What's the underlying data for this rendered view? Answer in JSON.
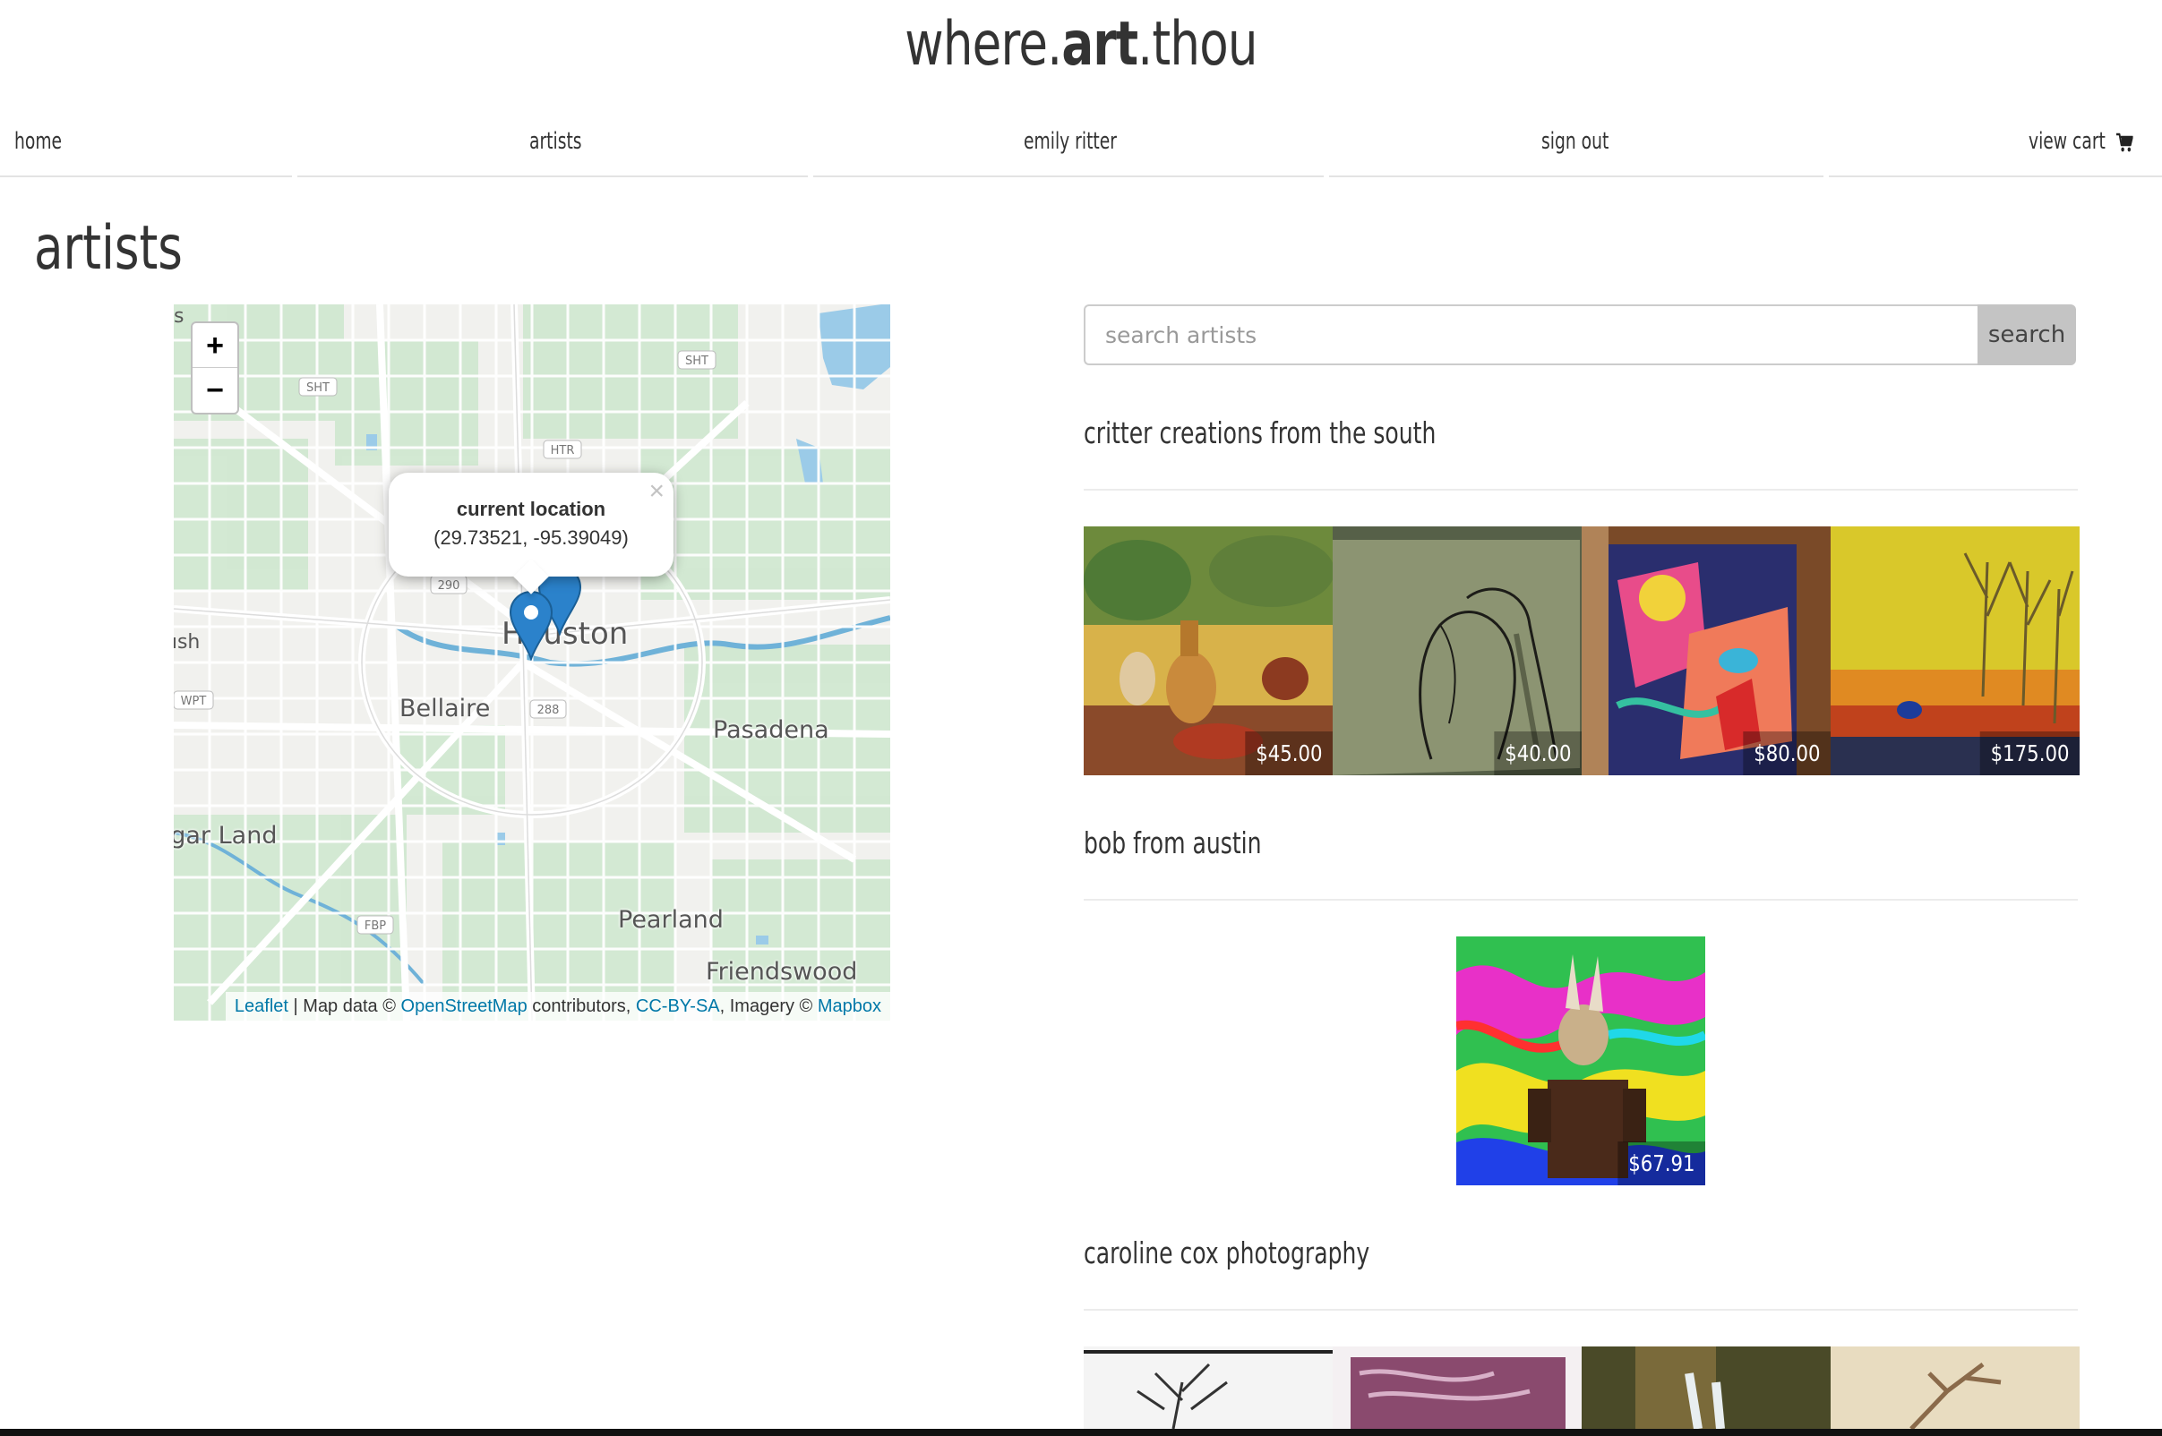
{
  "brand": {
    "part1": "where.",
    "part2": "art",
    "part3": ".thou"
  },
  "nav": {
    "home": "home",
    "artists": "artists",
    "user": "emily ritter",
    "sign_out": "sign out",
    "cart": "view cart"
  },
  "page_title": "artists",
  "map": {
    "zoom_in": "+",
    "zoom_out": "−",
    "labels": {
      "houston": "Houston",
      "bellaire": "Bellaire",
      "pasadena": "Pasadena",
      "sugar_land": "Sugar Land",
      "pearland": "Pearland",
      "friendswood": "Friendswood"
    },
    "popup": {
      "title": "current location",
      "coords": "(29.73521, -95.39049)",
      "close": "×"
    },
    "attribution": {
      "leaflet": "Leaflet",
      "sep": " | Map data © ",
      "osm": "OpenStreetMap",
      "contrib": " contributors, ",
      "license": "CC-BY-SA",
      "imagery": ", Imagery © ",
      "mapbox": "Mapbox"
    }
  },
  "search": {
    "placeholder": "search artists",
    "button": "search"
  },
  "artists": [
    {
      "name": "critter creations from the south",
      "items": [
        {
          "price": "$45.00"
        },
        {
          "price": "$40.00"
        },
        {
          "price": "$80.00"
        },
        {
          "price": "$175.00"
        }
      ]
    },
    {
      "name": "bob from austin",
      "items": [
        {
          "price": "$67.91"
        }
      ]
    },
    {
      "name": "caroline cox photography",
      "items": [
        {
          "price": ""
        },
        {
          "price": ""
        },
        {
          "price": ""
        },
        {
          "price": ""
        }
      ]
    }
  ],
  "colors": {
    "marker": "#2b82cb",
    "link": "#0078a8",
    "search_button": "#c4c4c4"
  }
}
